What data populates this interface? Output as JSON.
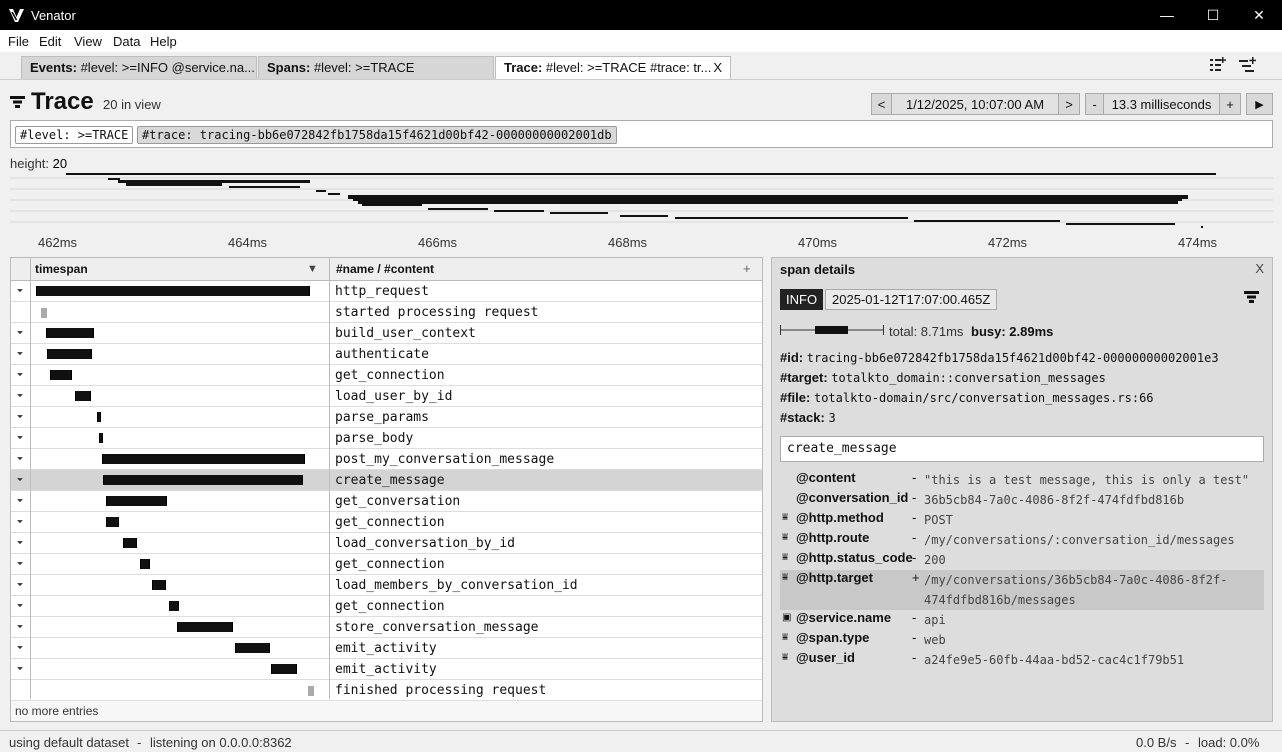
{
  "window": {
    "title": "Venator",
    "minimize": "—",
    "maximize": "☐",
    "close": "✕"
  },
  "menu": [
    "File",
    "Edit",
    "View",
    "Data",
    "Help"
  ],
  "tabs": [
    {
      "kind": "Events:",
      "query": " #level: >=INFO @service.na..."
    },
    {
      "kind": "Spans:",
      "query": " #level: >=TRACE"
    },
    {
      "kind": "Trace:",
      "query": " #level: >=TRACE #trace: tr...",
      "close": "X"
    }
  ],
  "header": {
    "title": "Trace",
    "count": "20 in view"
  },
  "controls": {
    "prev": "<",
    "datetime": "1/12/2025, 10:07:00 AM",
    "next": ">",
    "zoom_out": "-",
    "duration": "13.3 milliseconds",
    "zoom_in": "+",
    "play": "▶"
  },
  "filters": {
    "level": "#level: >=TRACE",
    "trace": "#trace: tracing-bb6e072842fb1758da15f4621d00bf42-00000000002001db"
  },
  "overview": {
    "height_label": "height:",
    "height_value": "20",
    "ticks": [
      "462ms",
      "464ms",
      "466ms",
      "468ms",
      "470ms",
      "472ms",
      "474ms"
    ]
  },
  "list": {
    "col_timespan": "timespan",
    "col_content": "#name / #content",
    "add": "+",
    "sort": "▼",
    "footer": "no more entries",
    "rows": [
      {
        "name": "http_request",
        "kind": "span",
        "start": 461.75,
        "end": 464.58
      },
      {
        "name": "started processing request",
        "kind": "event",
        "start": 461.8
      },
      {
        "name": "build_user_context",
        "kind": "span",
        "start": 461.85,
        "end": 462.35
      },
      {
        "name": "authenticate",
        "kind": "span",
        "start": 461.87,
        "end": 462.33
      },
      {
        "name": "get_connection",
        "kind": "span",
        "start": 461.9,
        "end": 462.12
      },
      {
        "name": "load_user_by_id",
        "kind": "span",
        "start": 462.15,
        "end": 462.32
      },
      {
        "name": "parse_params",
        "kind": "span",
        "start": 462.38,
        "end": 462.42
      },
      {
        "name": "parse_body",
        "kind": "span",
        "start": 462.4,
        "end": 462.44
      },
      {
        "name": "post_my_conversation_message",
        "kind": "span",
        "start": 462.43,
        "end": 464.52,
        "selected": false
      },
      {
        "name": "create_message",
        "kind": "span",
        "start": 462.44,
        "end": 464.5,
        "selected": true
      },
      {
        "name": "get_conversation",
        "kind": "span",
        "start": 462.47,
        "end": 463.1
      },
      {
        "name": "get_connection",
        "kind": "span",
        "start": 462.47,
        "end": 462.61
      },
      {
        "name": "load_conversation_by_id",
        "kind": "span",
        "start": 462.65,
        "end": 462.79
      },
      {
        "name": "get_connection",
        "kind": "span",
        "start": 462.82,
        "end": 462.93
      },
      {
        "name": "load_members_by_conversation_id",
        "kind": "span",
        "start": 462.95,
        "end": 463.09
      },
      {
        "name": "get_connection",
        "kind": "span",
        "start": 463.12,
        "end": 463.23
      },
      {
        "name": "store_conversation_message",
        "kind": "span",
        "start": 463.2,
        "end": 463.78
      },
      {
        "name": "emit_activity",
        "kind": "span",
        "start": 463.8,
        "end": 464.16
      },
      {
        "name": "emit_activity",
        "kind": "span",
        "start": 464.17,
        "end": 464.44
      },
      {
        "name": "finished processing request",
        "kind": "event",
        "start": 464.55
      }
    ]
  },
  "details": {
    "header": "span details",
    "close": "X",
    "level": "INFO",
    "timestamp": "2025-01-12T17:07:00.465Z",
    "total": "total: 8.71ms",
    "busy": "busy: 2.89ms",
    "fields": [
      {
        "key": "#id:",
        "value": "tracing-bb6e072842fb1758da15f4621d00bf42-00000000002001e3"
      },
      {
        "key": "#target:",
        "value": "totalkto_domain::conversation_messages"
      },
      {
        "key": "#file:",
        "value": "totalkto-domain/src/conversation_messages.rs:66"
      },
      {
        "key": "#stack:",
        "value": "3"
      }
    ],
    "name": "create_message",
    "attributes": [
      {
        "icon": "",
        "key": "@content",
        "sep": "-",
        "value": "\"this is a test message, this is only a test\""
      },
      {
        "icon": "",
        "key": "@conversation_id",
        "sep": "-",
        "value": "36b5cb84-7a0c-4086-8f2f-474fdfbd816b"
      },
      {
        "icon": "⩸",
        "key": "@http.method",
        "sep": "-",
        "value": "POST"
      },
      {
        "icon": "⩸",
        "key": "@http.route",
        "sep": "-",
        "value": "/my/conversations/:conversation_id/messages"
      },
      {
        "icon": "⩸",
        "key": "@http.status_code",
        "sep": "-",
        "value": "200"
      },
      {
        "icon": "⩸",
        "key": "@http.target",
        "sep": "+",
        "value": "/my/conversations/36b5cb84-7a0c-4086-8f2f-474fdfbd816b/messages"
      },
      {
        "icon": "▣",
        "key": "@service.name",
        "sep": "-",
        "value": "api"
      },
      {
        "icon": "⩸",
        "key": "@span.type",
        "sep": "-",
        "value": "web"
      },
      {
        "icon": "⩸",
        "key": "@user_id",
        "sep": "-",
        "value": "a24fe9e5-60fb-44aa-bd52-cac4c1f79b51"
      }
    ]
  },
  "status": {
    "dataset": "using default dataset",
    "sep": "-",
    "listening": "listening on 0.0.0.0:8362",
    "rate": "0.0 B/s",
    "sep2": "-",
    "load": "load: 0.0%"
  }
}
